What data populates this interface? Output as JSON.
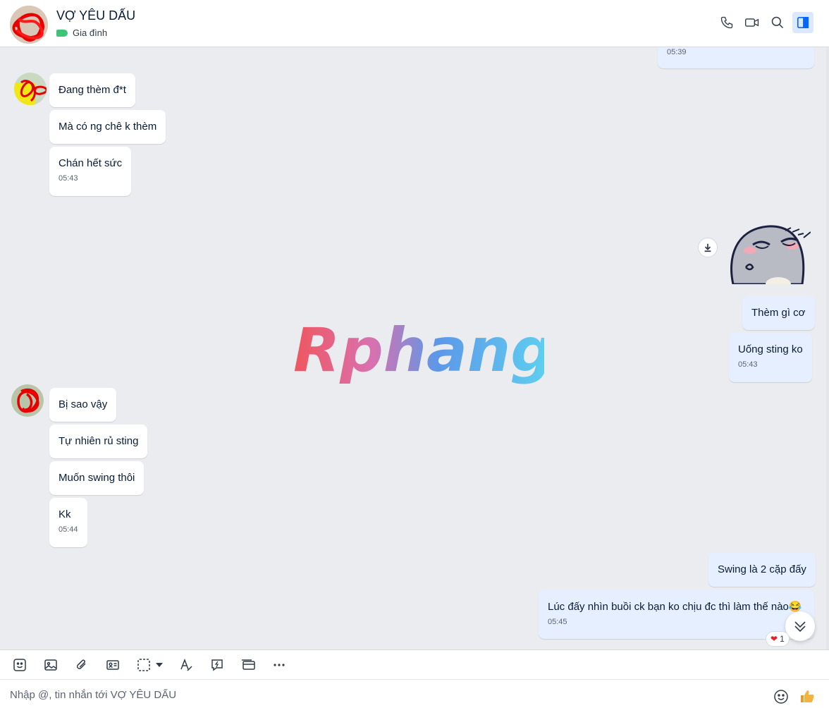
{
  "header": {
    "title": "VỢ YÊU DẤU",
    "tag_label": "Gia đình"
  },
  "watermark_text": "Rphang",
  "messages": {
    "prev_time": "05:39",
    "them_group1": [
      "Đang thèm đ*t",
      "Mà có ng chê k thèm",
      "Chán hết sức"
    ],
    "them_group1_time": "05:43",
    "me_group1": [
      "Thèm gì cơ",
      "Uống sting ko"
    ],
    "me_group1_time": "05:43",
    "them_group2": [
      "Bị sao vậy",
      "Tự nhiên rủ sting",
      "Muốn swing thôi",
      "Kk"
    ],
    "them_group2_time": "05:44",
    "me_group2": [
      "Swing là 2 cặp đấy",
      "Lúc đấy nhìn buồi ck bạn ko chịu đc thì làm thế nào😂"
    ],
    "me_group2_time": "05:45",
    "reaction_count": "1"
  },
  "input": {
    "placeholder": "Nhập @, tin nhắn tới VỢ YÊU DẤU"
  },
  "icons": {
    "header": [
      "phone-icon",
      "video-icon",
      "search-icon",
      "sidebar-toggle-icon"
    ],
    "toolbar": [
      "sticker-icon",
      "image-icon",
      "attach-icon",
      "contact-card-icon",
      "screenshot-icon",
      "format-text-icon",
      "quick-message-icon",
      "card-icon",
      "more-icon"
    ]
  },
  "colors": {
    "accent": "#0068ff",
    "my_bubble": "#e5efff",
    "their_bubble": "#ffffff",
    "background": "#ebecf0"
  }
}
